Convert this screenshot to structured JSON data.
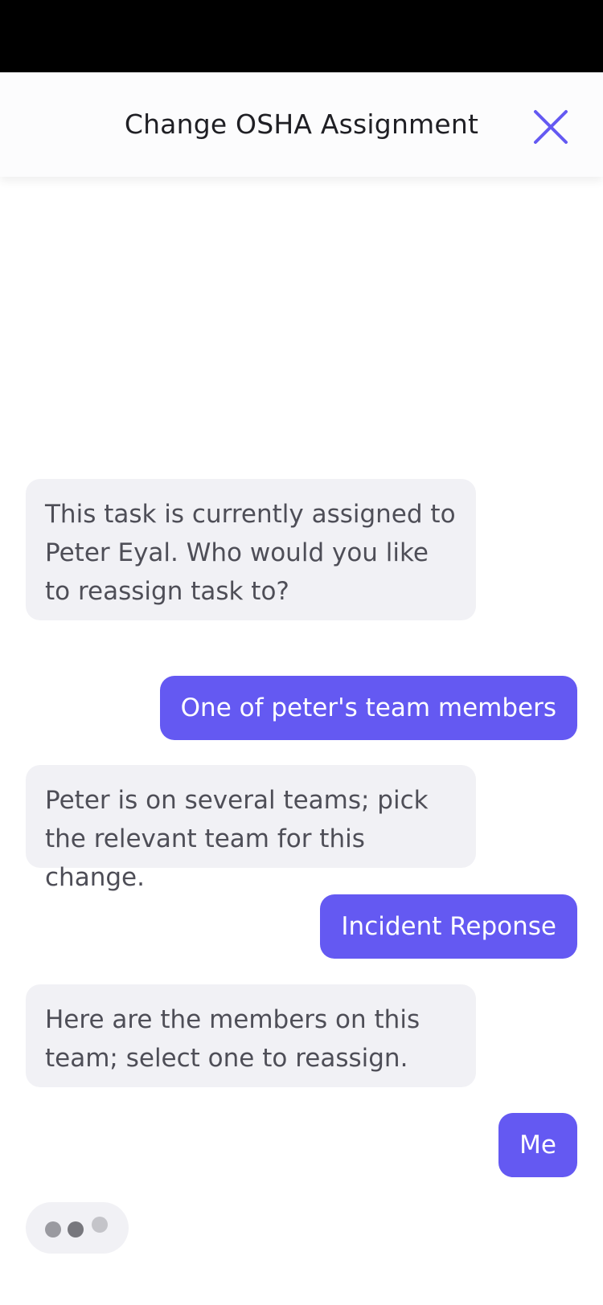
{
  "header": {
    "title": "Change OSHA Assignment",
    "close_icon": "close-icon",
    "accent_color": "#6459f2"
  },
  "messages": [
    {
      "sender": "bot",
      "text": "This task is currently assigned to Peter Eyal. Who would you like to reassign task to?"
    },
    {
      "sender": "user",
      "text": "One of peter's team members"
    },
    {
      "sender": "bot",
      "text": "Peter is on several teams; pick the relevant team for this change."
    },
    {
      "sender": "user",
      "text": "Incident Reponse"
    },
    {
      "sender": "bot",
      "text": "Here are the members on this team; select one to reassign."
    },
    {
      "sender": "user",
      "text": "Me"
    }
  ],
  "typing_indicator": "typing-dots-icon"
}
